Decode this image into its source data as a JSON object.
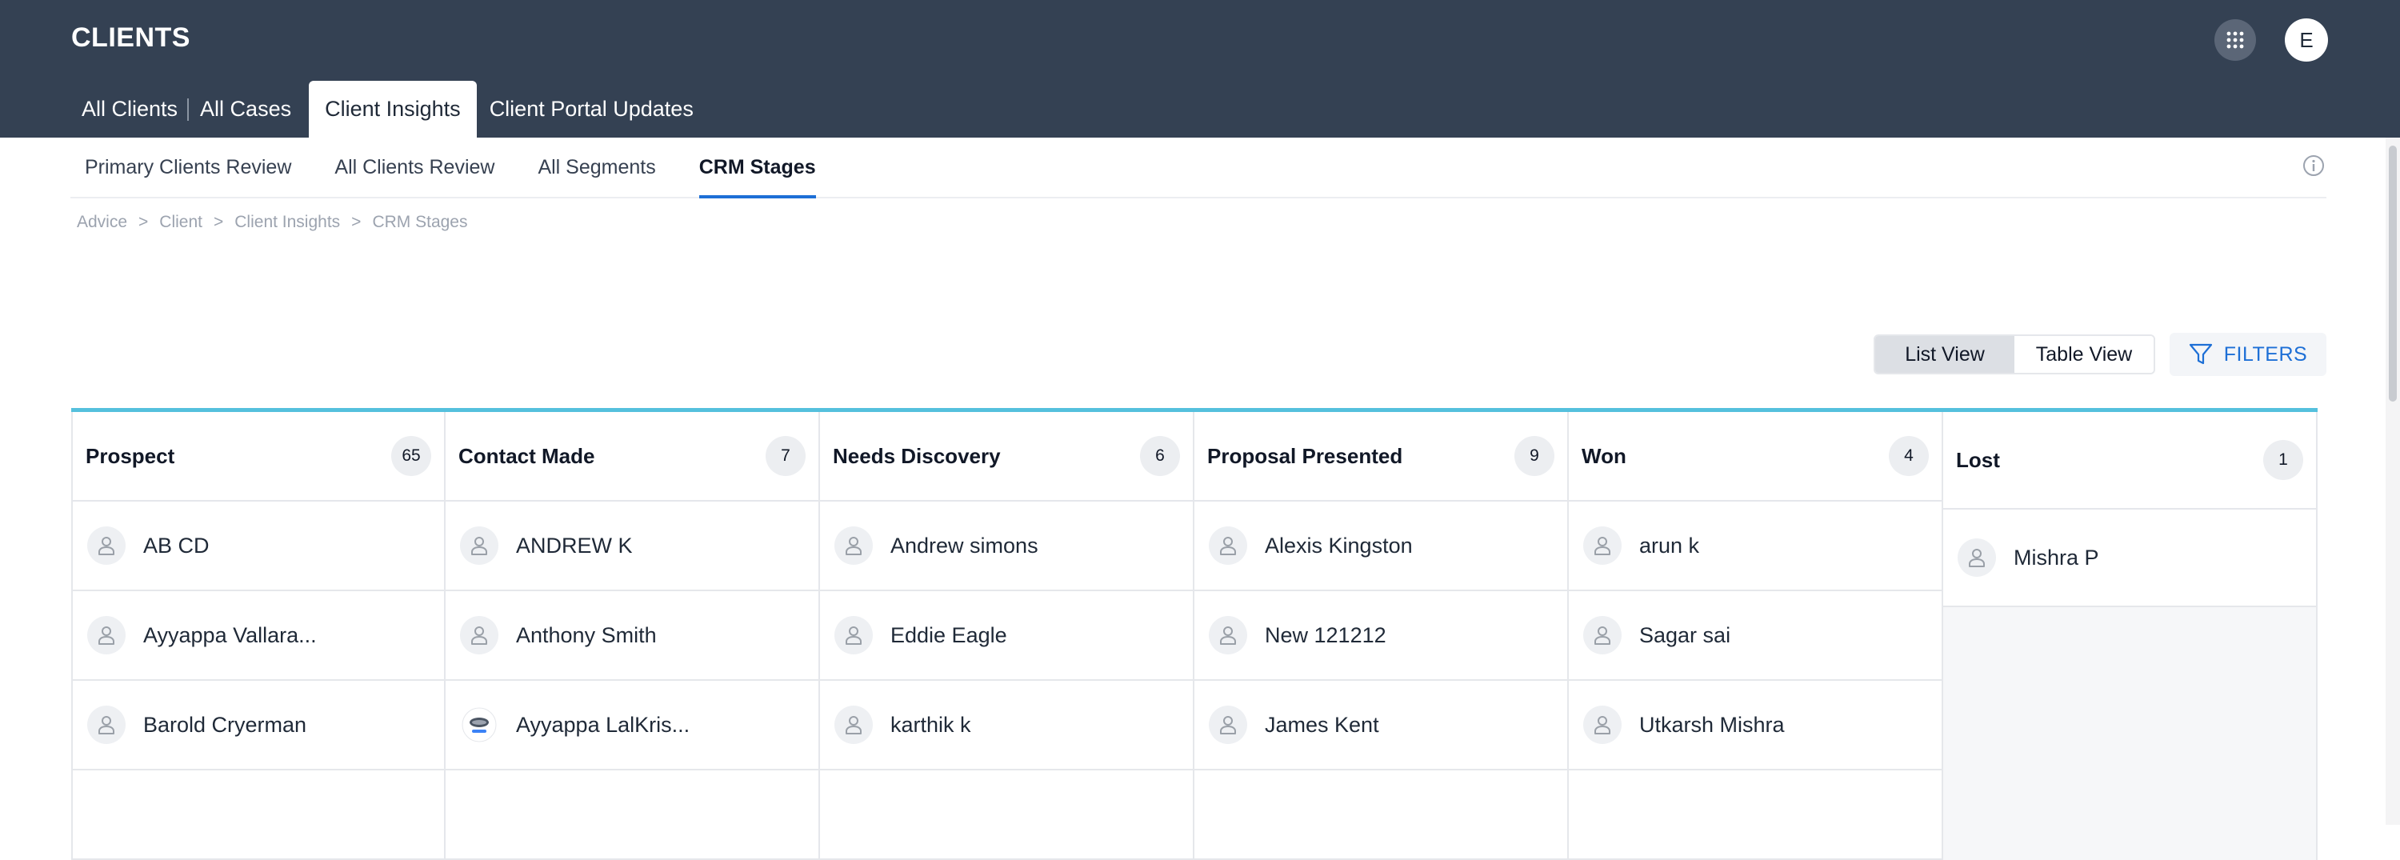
{
  "header": {
    "title": "CLIENTS",
    "avatar_initial": "E",
    "tabs": [
      {
        "label": "All Clients"
      },
      {
        "label": "All Cases"
      },
      {
        "label": "Client Insights"
      },
      {
        "label": "Client Portal Updates"
      }
    ]
  },
  "subtabs": [
    {
      "label": "Primary Clients Review"
    },
    {
      "label": "All Clients Review"
    },
    {
      "label": "All Segments"
    },
    {
      "label": "CRM Stages"
    }
  ],
  "breadcrumb": [
    "Advice",
    "Client",
    "Client Insights",
    "CRM Stages"
  ],
  "breadcrumb_separator": ">",
  "view_toggle": {
    "list": "List View",
    "table": "Table View",
    "active": "List View"
  },
  "filters_label": "FILTERS",
  "colors": {
    "header_bg": "#344153",
    "accent_blue": "#1d6fd6",
    "board_top_border": "#55c0dd"
  },
  "board": {
    "columns": [
      {
        "title": "Prospect",
        "count": "65",
        "cards": [
          "AB CD",
          "Ayyappa Vallara...",
          "Barold Cryerman"
        ]
      },
      {
        "title": "Contact Made",
        "count": "7",
        "cards": [
          "ANDREW K",
          "Anthony Smith",
          "Ayyappa LalKris..."
        ]
      },
      {
        "title": "Needs Discovery",
        "count": "6",
        "cards": [
          "Andrew simons",
          "Eddie Eagle",
          "karthik k"
        ]
      },
      {
        "title": "Proposal Presented",
        "count": "9",
        "cards": [
          "Alexis Kingston",
          "New 121212",
          "James Kent"
        ]
      },
      {
        "title": "Won",
        "count": "4",
        "cards": [
          "arun k",
          "Sagar sai",
          "Utkarsh Mishra"
        ]
      },
      {
        "title": "Lost",
        "count": "1",
        "cards": [
          "Mishra P"
        ]
      }
    ]
  }
}
